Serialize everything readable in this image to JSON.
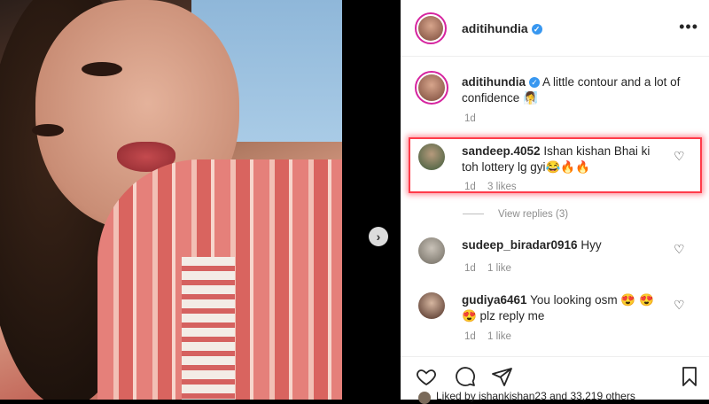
{
  "post": {
    "username": "aditihundia",
    "verified": true,
    "caption": "A little contour and a lot of confidence",
    "caption_emoji": "🧖‍♀️",
    "time": "1d"
  },
  "header": {
    "username": "aditihundia",
    "more_label": "•••"
  },
  "comments": [
    {
      "username": "sandeep.4052",
      "text": "Ishan kishan Bhai ki toh lottery lg gyi😂🔥🔥",
      "time": "1d",
      "likes": "3 likes",
      "view_replies": "View replies (3)",
      "highlighted": true
    },
    {
      "username": "sudeep_biradar0916",
      "text": "Hyy",
      "time": "1d",
      "likes": "1 like"
    },
    {
      "username": "gudiya6461",
      "text": "You looking osm 😍 😍😍 plz reply me",
      "time": "1d",
      "likes": "1 like"
    }
  ],
  "actions": {
    "like_icon": "heart-outline",
    "comment_icon": "speech-bubble",
    "share_icon": "paper-plane",
    "save_icon": "bookmark"
  },
  "likes_summary": "Liked by ishankishan23 and 33,219 others",
  "colors": {
    "highlight": "#ff3b4a",
    "verified": "#3897f0",
    "story_ring": "#d6249f"
  }
}
